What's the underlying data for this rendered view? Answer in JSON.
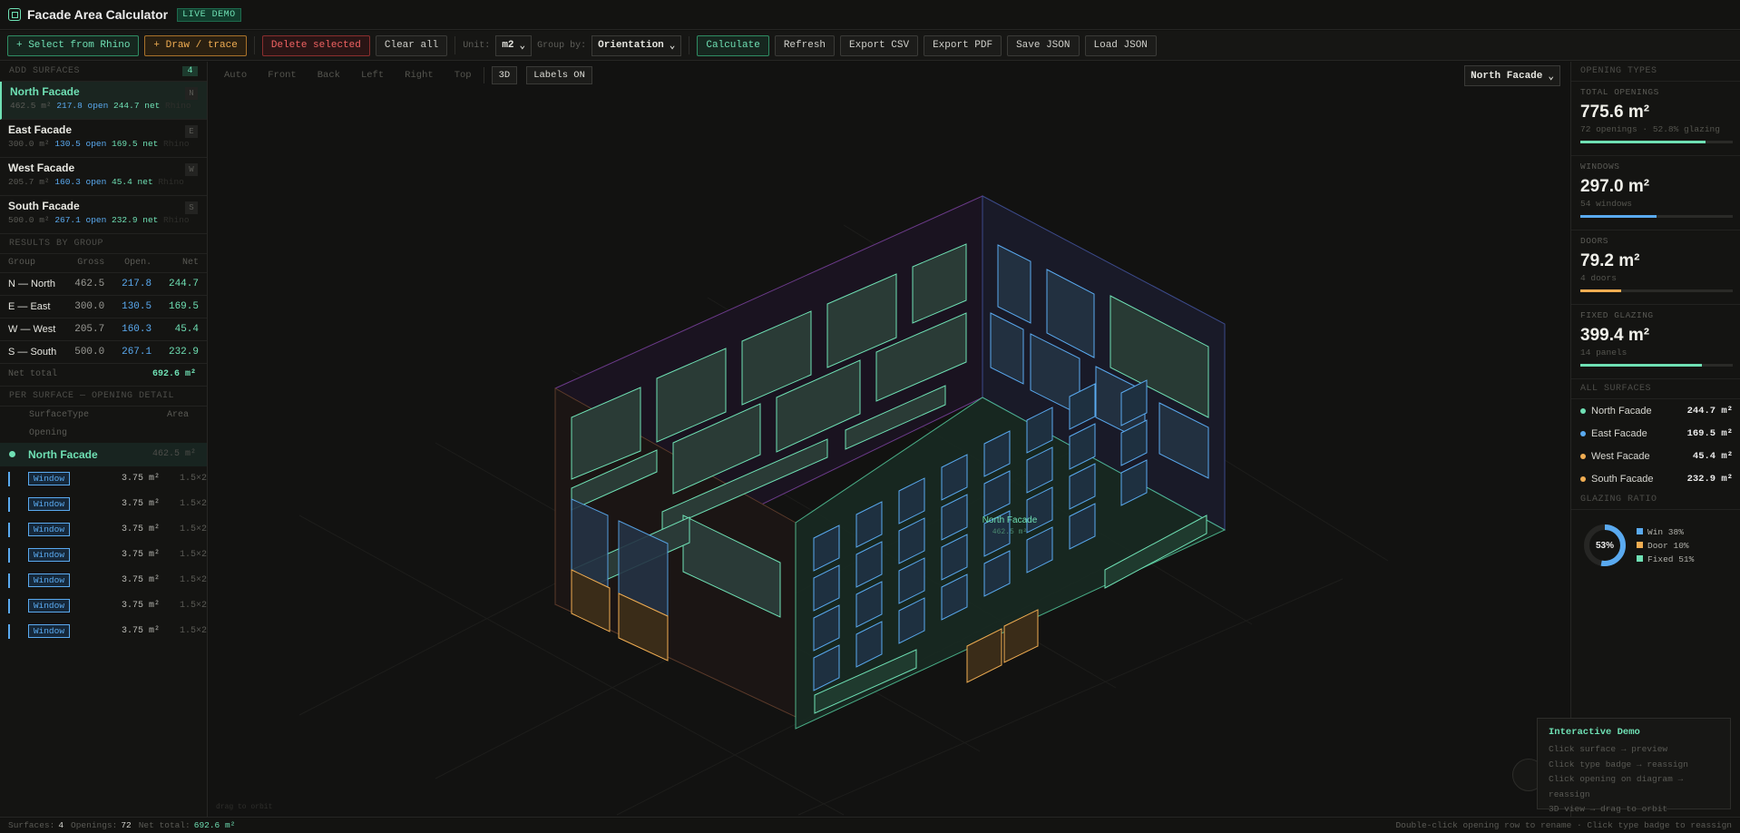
{
  "app": {
    "title": "Facade Area Calculator",
    "badge": "LIVE DEMO"
  },
  "toolbar": {
    "select_rhino": "+ Select from Rhino",
    "draw": "+ Draw / trace",
    "delete": "Delete selected",
    "clear": "Clear all",
    "unit_label": "Unit:",
    "unit_value": "m2",
    "group_label": "Group by:",
    "group_value": "Orientation",
    "calculate": "Calculate",
    "refresh": "Refresh",
    "export_csv": "Export CSV",
    "export_pdf": "Export PDF",
    "save_json": "Save JSON",
    "load_json": "Load JSON"
  },
  "left": {
    "surfaces_heading": "ADD SURFACES",
    "surfaces_count": "4",
    "surfaces": [
      {
        "name": "North Facade",
        "gross": "462.5 m²",
        "open": "217.8 open",
        "net": "244.7 net",
        "src": "Rhino",
        "tag": "N"
      },
      {
        "name": "East Facade",
        "gross": "300.0 m²",
        "open": "130.5 open",
        "net": "169.5 net",
        "src": "Rhino",
        "tag": "E"
      },
      {
        "name": "West Facade",
        "gross": "205.7 m²",
        "open": "160.3 open",
        "net": "45.4 net",
        "src": "Rhino",
        "tag": "W"
      },
      {
        "name": "South Facade",
        "gross": "500.0 m²",
        "open": "267.1 open",
        "net": "232.9 net",
        "src": "Rhino",
        "tag": "S"
      }
    ],
    "results_heading": "RESULTS BY GROUP",
    "results_cols": [
      "Group",
      "Gross",
      "Open.",
      "Net"
    ],
    "results": [
      {
        "group": "N — North",
        "gross": "462.5",
        "open": "217.8",
        "net": "244.7"
      },
      {
        "group": "E — East",
        "gross": "300.0",
        "open": "130.5",
        "net": "169.5"
      },
      {
        "group": "W — West",
        "gross": "205.7",
        "open": "160.3",
        "net": "45.4"
      },
      {
        "group": "S — South",
        "gross": "500.0",
        "open": "267.1",
        "net": "232.9"
      }
    ],
    "net_total_label": "Net total",
    "net_total": "692.6 m²",
    "per_surface_heading": "PER SURFACE — OPENING DETAIL",
    "ps_cols": [
      "SurfaceType",
      "Area",
      "Opening"
    ],
    "ps_group": {
      "name": "North Facade",
      "area": "462.5 m²"
    },
    "openings": [
      {
        "type": "Window",
        "area": "3.75 m²",
        "size": "1.5×2"
      },
      {
        "type": "Window",
        "area": "3.75 m²",
        "size": "1.5×2"
      },
      {
        "type": "Window",
        "area": "3.75 m²",
        "size": "1.5×2"
      },
      {
        "type": "Window",
        "area": "3.75 m²",
        "size": "1.5×2"
      },
      {
        "type": "Window",
        "area": "3.75 m²",
        "size": "1.5×2"
      },
      {
        "type": "Window",
        "area": "3.75 m²",
        "size": "1.5×2"
      },
      {
        "type": "Window",
        "area": "3.75 m²",
        "size": "1.5×2"
      }
    ]
  },
  "viewport": {
    "views": [
      "Auto",
      "Front",
      "Back",
      "Left",
      "Right",
      "Top"
    ],
    "mode": "3D",
    "labels": "Labels ON",
    "surface_select": "North Facade",
    "label_name": "North Facade",
    "label_area": "462.5 m²",
    "hint": "drag to orbit"
  },
  "right": {
    "heading": "OPENING TYPES",
    "stats": [
      {
        "key": "TOTAL OPENINGS",
        "value": "775.6 m²",
        "sub": "72 openings · 52.8% glazing",
        "color": "#6fe0b4",
        "ratio": 0.82
      },
      {
        "key": "WINDOWS",
        "value": "297.0 m²",
        "sub": "54 windows",
        "color": "#5aaaf0",
        "ratio": 0.5
      },
      {
        "key": "DOORS",
        "value": "79.2 m²",
        "sub": "4 doors",
        "color": "#f0ad52",
        "ratio": 0.27
      },
      {
        "key": "FIXED GLAZING",
        "value": "399.4 m²",
        "sub": "14 panels",
        "color": "#6fe0b4",
        "ratio": 0.8
      }
    ],
    "all_heading": "ALL SURFACES",
    "all": [
      {
        "name": "North Facade",
        "value": "244.7 m²",
        "color": "#6fe0b4"
      },
      {
        "name": "East Facade",
        "value": "169.5 m²",
        "color": "#5aaaf0"
      },
      {
        "name": "West Facade",
        "value": "45.4 m²",
        "color": "#f0ad52"
      },
      {
        "name": "South Facade",
        "value": "232.9 m²",
        "color": "#f0ad52"
      }
    ],
    "ratio_heading": "GLAZING RATIO",
    "ratio_center": "53%",
    "ratio_legend": [
      {
        "label": "Win 38%",
        "color": "#5aaaf0"
      },
      {
        "label": "Door 10%",
        "color": "#f0ad52"
      },
      {
        "label": "Fixed 51%",
        "color": "#6fe0b4"
      }
    ],
    "ratio_fraction": 0.53
  },
  "demo": {
    "title": "Interactive Demo",
    "lines": [
      "Click surface → preview",
      "Click type badge → reassign",
      "Click opening on diagram → reassign",
      "3D view → drag to orbit"
    ]
  },
  "status": {
    "surfaces_label": "Surfaces:",
    "surfaces": "4",
    "openings_label": "Openings:",
    "openings": "72",
    "net_label": "Net total:",
    "net": "692.6 m²",
    "hint": "Double-click opening row to rename · Click type badge to reassign"
  }
}
